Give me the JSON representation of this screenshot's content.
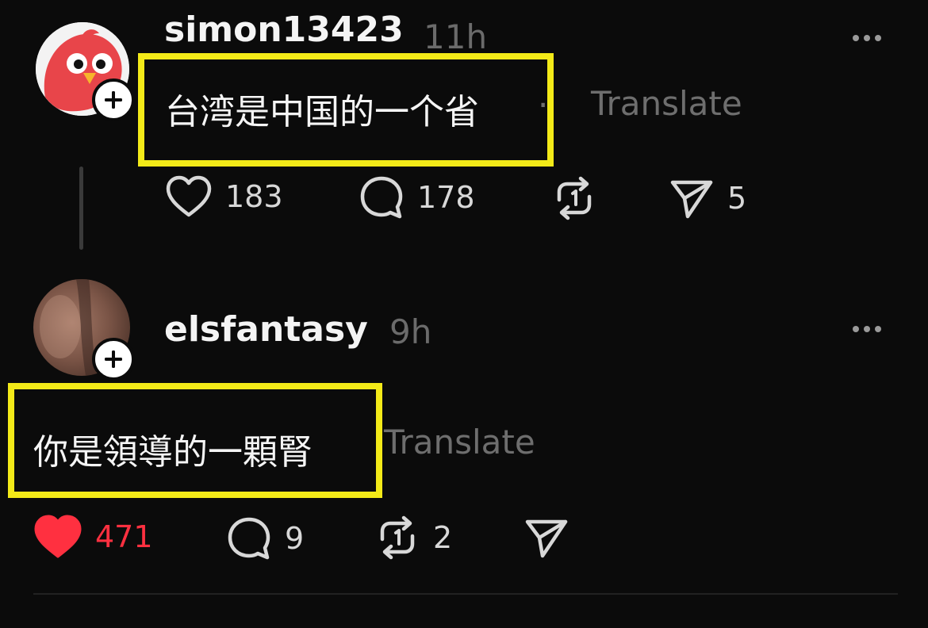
{
  "posts": [
    {
      "username": "simon13423",
      "time": "11h",
      "text": "台湾是中国的一个省",
      "separator": "·",
      "translate": "Translate",
      "likes": "183",
      "replies": "178",
      "reposts": "",
      "shares": "5",
      "liked": false
    },
    {
      "username": "elsfantasy",
      "time": "9h",
      "text": "你是領導的一顆腎",
      "translate": "Translate",
      "likes": "471",
      "replies": "9",
      "reposts": "2",
      "shares": "",
      "liked": true
    }
  ],
  "icons": {
    "follow": "plus-icon",
    "more": "more-horizontal-icon",
    "like": "heart-icon",
    "reply": "comment-bubble-icon",
    "repost": "repost-icon",
    "share": "send-icon"
  },
  "colors": {
    "background": "#0b0b0b",
    "highlight": "#f3ea18",
    "like_active": "#ff3040",
    "muted": "#6e6e6e"
  }
}
